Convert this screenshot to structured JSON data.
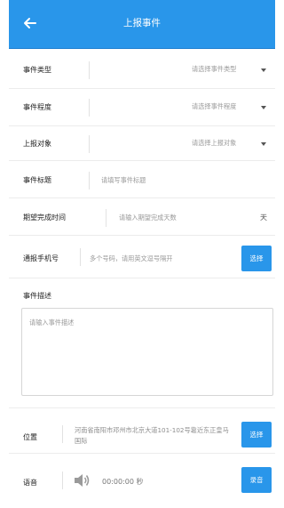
{
  "header": {
    "title": "上报事件",
    "back_icon": "arrow-left-icon"
  },
  "form": {
    "event_type": {
      "label": "事件类型",
      "placeholder": "请选择事件类型"
    },
    "severity": {
      "label": "事件程度",
      "placeholder": "请选择事件程度"
    },
    "report_target": {
      "label": "上报对象",
      "placeholder": "请选择上报对象"
    },
    "event_title": {
      "label": "事件标题",
      "placeholder": "请填写事件标题"
    },
    "due_time": {
      "label": "期望完成时间",
      "placeholder": "请输入期望完成天数",
      "unit": "天"
    },
    "notify_phone": {
      "label": "通报手机号",
      "placeholder": "多个号码，请用英文逗号隔开",
      "button": "选择"
    },
    "description": {
      "label": "事件描述",
      "placeholder": "请输入事件描述"
    },
    "location": {
      "label": "位置",
      "address": "河南省南阳市邓州市北京大道101-102号靠近东正皇马国际",
      "button": "选择"
    },
    "voice": {
      "label": "语音",
      "duration": "00:00:00 秒",
      "button": "录音",
      "icon": "speaker-icon"
    }
  },
  "colors": {
    "accent": "#2996ea"
  }
}
